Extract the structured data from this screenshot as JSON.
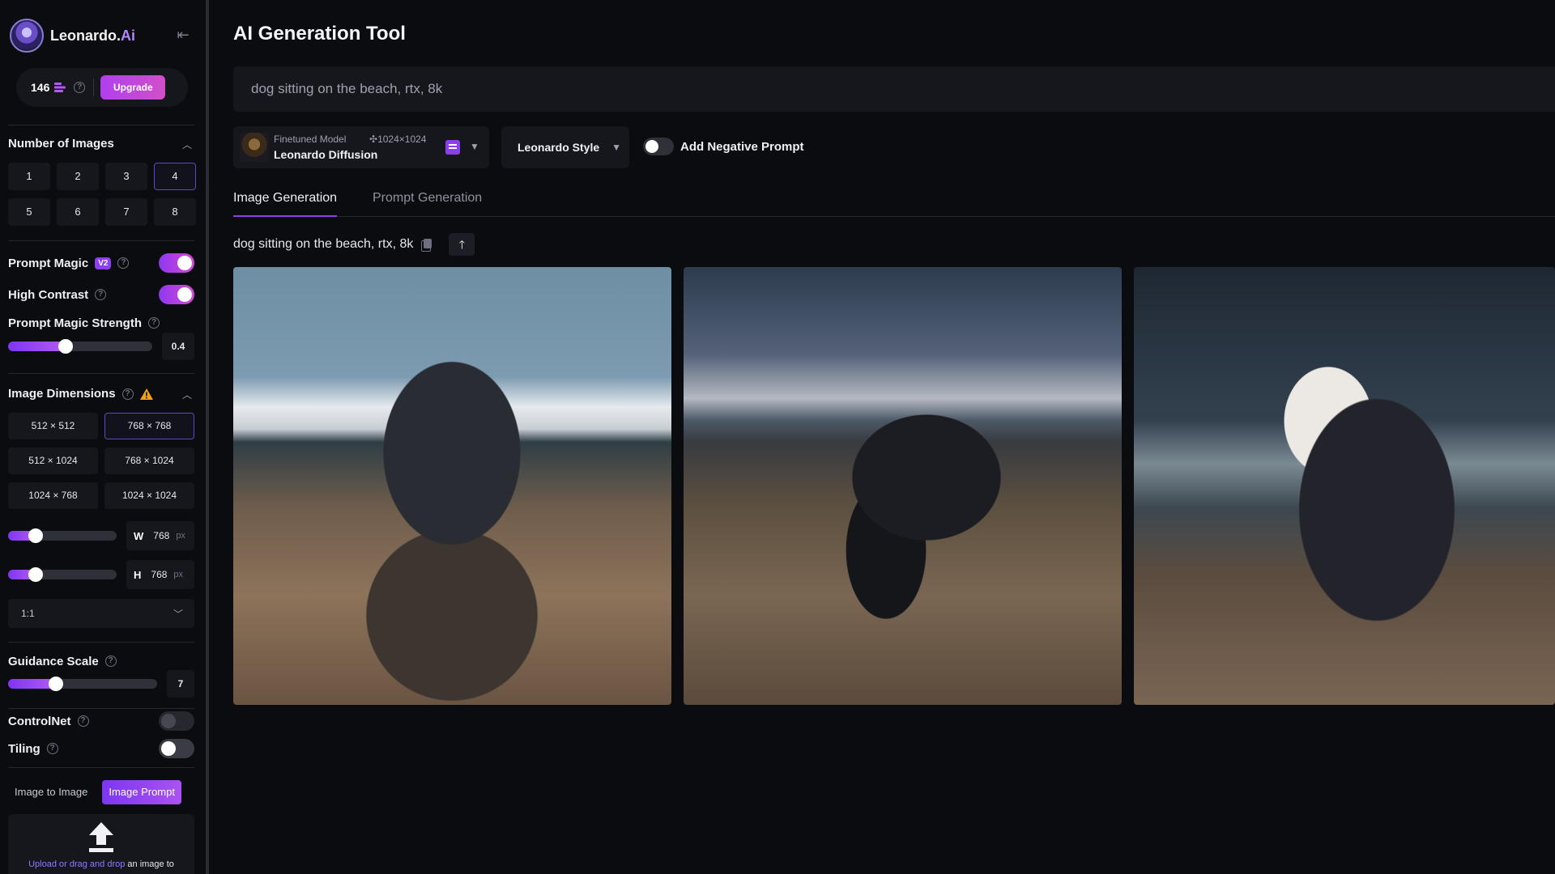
{
  "sidebar": {
    "brand": {
      "name": "Leonardo.",
      "suffix": "Ai"
    },
    "credits": {
      "count": "146",
      "upgrade_label": "Upgrade"
    },
    "number_of_images": {
      "title": "Number of Images",
      "options": [
        "1",
        "2",
        "3",
        "4",
        "5",
        "6",
        "7",
        "8"
      ],
      "selected": "4"
    },
    "prompt_magic": {
      "label": "Prompt Magic",
      "badge": "V2",
      "enabled": true
    },
    "high_contrast": {
      "label": "High Contrast",
      "enabled": true
    },
    "prompt_magic_strength": {
      "label": "Prompt Magic Strength",
      "value": "0.4",
      "fraction": 0.4
    },
    "image_dimensions": {
      "title": "Image Dimensions",
      "options": [
        "512 × 512",
        "768 × 768",
        "512 × 1024",
        "768 × 1024",
        "1024 × 768",
        "1024 × 1024"
      ],
      "selected": "768 × 768",
      "width": {
        "key": "W",
        "value": "768",
        "unit": "px",
        "fraction": 0.25
      },
      "height": {
        "key": "H",
        "value": "768",
        "unit": "px",
        "fraction": 0.25
      },
      "aspect_ratio": "1:1"
    },
    "guidance_scale": {
      "label": "Guidance Scale",
      "value": "7",
      "fraction": 0.32
    },
    "controlnet": {
      "label": "ControlNet",
      "enabled": false
    },
    "tiling": {
      "label": "Tiling",
      "enabled": false
    },
    "image_tabs": {
      "image_to_image": "Image to Image",
      "image_prompt": "Image Prompt",
      "active": "Image Prompt"
    },
    "upload": {
      "link_text": "Upload or drag and drop",
      "rest_text": " an image to"
    }
  },
  "main": {
    "title": "AI Generation Tool",
    "prompt": "dog sitting on the beach, rtx, 8k",
    "model": {
      "subtitle": "Finetuned Model",
      "name": "Leonardo Diffusion",
      "resolution": "1024×1024"
    },
    "style": "Leonardo Style",
    "negative_prompt": {
      "label": "Add Negative Prompt",
      "enabled": false
    },
    "tabs": [
      "Image Generation",
      "Prompt Generation"
    ],
    "active_tab": "Image Generation",
    "generation": {
      "prompt": "dog sitting on the beach, rtx, 8k",
      "images": [
        "dog-sitting-beach-1",
        "dog-standing-beach-2",
        "dog-lying-beach-3"
      ]
    }
  },
  "colors": {
    "accent": "#8b3ff0",
    "background": "#0b0c0f",
    "panel": "#16171d"
  }
}
